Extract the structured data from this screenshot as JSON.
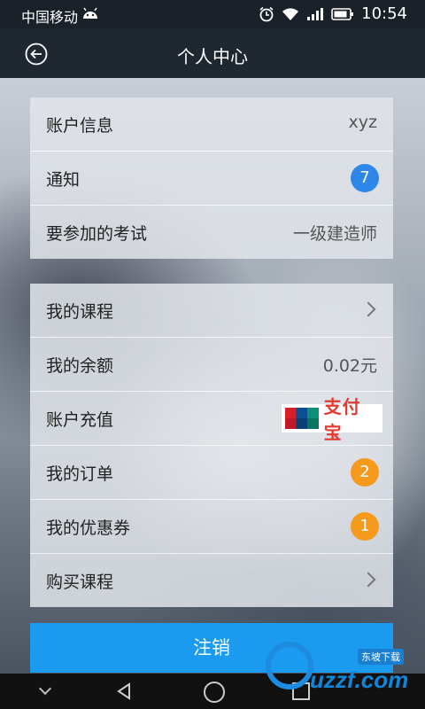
{
  "status_bar": {
    "carrier": "中国移动",
    "time": "10:54"
  },
  "header": {
    "title": "个人中心"
  },
  "group1": [
    {
      "label": "账户信息",
      "value": "xyz"
    },
    {
      "label": "通知",
      "badge": "7"
    },
    {
      "label": "要参加的考试",
      "value": "一级建造师"
    }
  ],
  "group2": [
    {
      "label": "我的课程"
    },
    {
      "label": "我的余额",
      "value": "0.02元"
    },
    {
      "label": "账户充值",
      "payment_logo": "支付宝"
    },
    {
      "label": "我的订单",
      "badge": "2"
    },
    {
      "label": "我的优惠券",
      "badge": "1"
    },
    {
      "label": "购买课程"
    }
  ],
  "logout_label": "注销",
  "watermark": {
    "text": "uzzf.com",
    "tag": "东坡下载"
  },
  "colors": {
    "accent": "#1a9bf0",
    "badge_blue": "#2d87e9",
    "badge_orange": "#f59a1d"
  }
}
